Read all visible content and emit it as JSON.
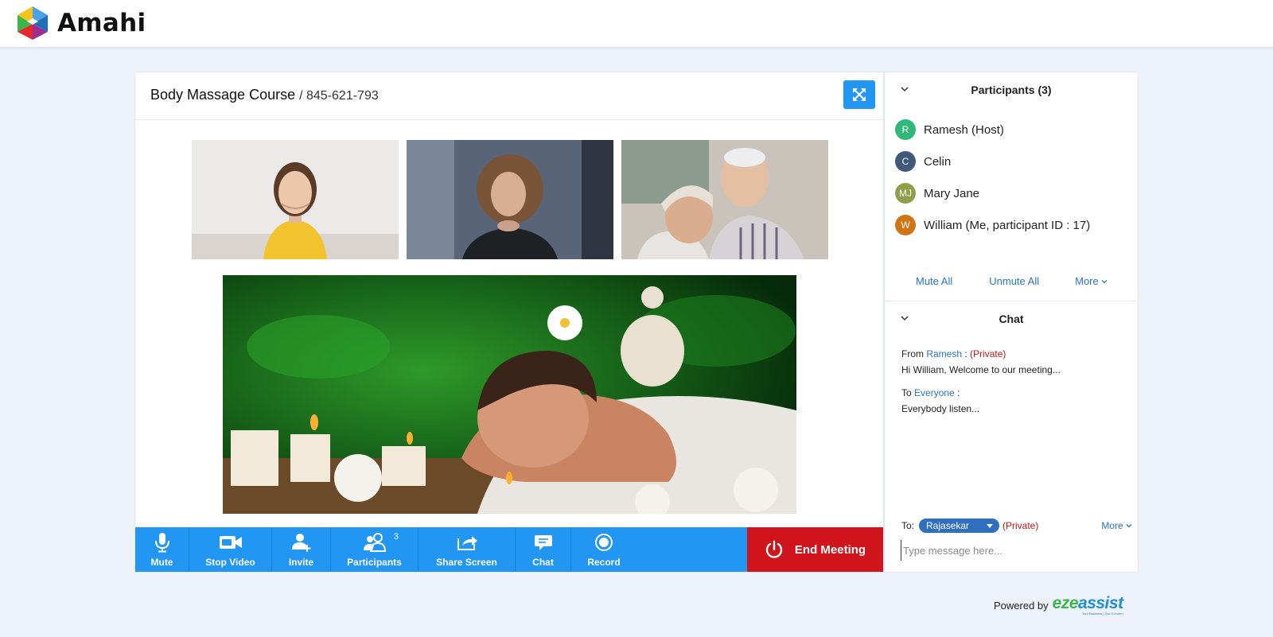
{
  "app": {
    "name": "Amahi"
  },
  "meeting": {
    "title": "Body Massage Course",
    "id": "845-621-793"
  },
  "toolbar": {
    "mute": "Mute",
    "stop_video": "Stop Video",
    "invite": "Invite",
    "participants": "Participants",
    "participants_count": "3",
    "share_screen": "Share Screen",
    "chat": "Chat",
    "record": "Record",
    "end_meeting": "End Meeting"
  },
  "participants_panel": {
    "title": "Participants (3)",
    "list": [
      {
        "initials": "R",
        "name": "Ramesh (Host)",
        "color": "#2fb879"
      },
      {
        "initials": "C",
        "name": "Celin",
        "color": "#3f5a79"
      },
      {
        "initials": "MJ",
        "name": "Mary Jane",
        "color": "#8f9f48"
      },
      {
        "initials": "W",
        "name": "William (Me, participant ID : 17)",
        "color": "#d07414"
      }
    ],
    "actions": {
      "mute_all": "Mute All",
      "unmute_all": "Unmute All",
      "more": "More"
    }
  },
  "chat_panel": {
    "title": "Chat",
    "messages": [
      {
        "prefix": "From",
        "who": "Ramesh",
        "sep": " :",
        "tag": "(Private)",
        "text": "Hi William, Welcome to our meeting..."
      },
      {
        "prefix": "To",
        "who": "Everyone",
        "sep": " :",
        "tag": "",
        "text": "Everybody listen..."
      }
    ],
    "to_label": "To:",
    "recipient": "Rajasekar",
    "recipient_tag": "(Private)",
    "more": "More",
    "input_placeholder": "Type message here..."
  },
  "footer": {
    "powered_by": "Powered by",
    "brand_a": "eze",
    "brand_b": "assist",
    "brand_tag": "Your Business | Our Concern"
  },
  "colors": {
    "accent_blue": "#2196f3",
    "end_red": "#d0141b",
    "link_blue": "#2b73c9",
    "private_red": "#c3131b"
  }
}
